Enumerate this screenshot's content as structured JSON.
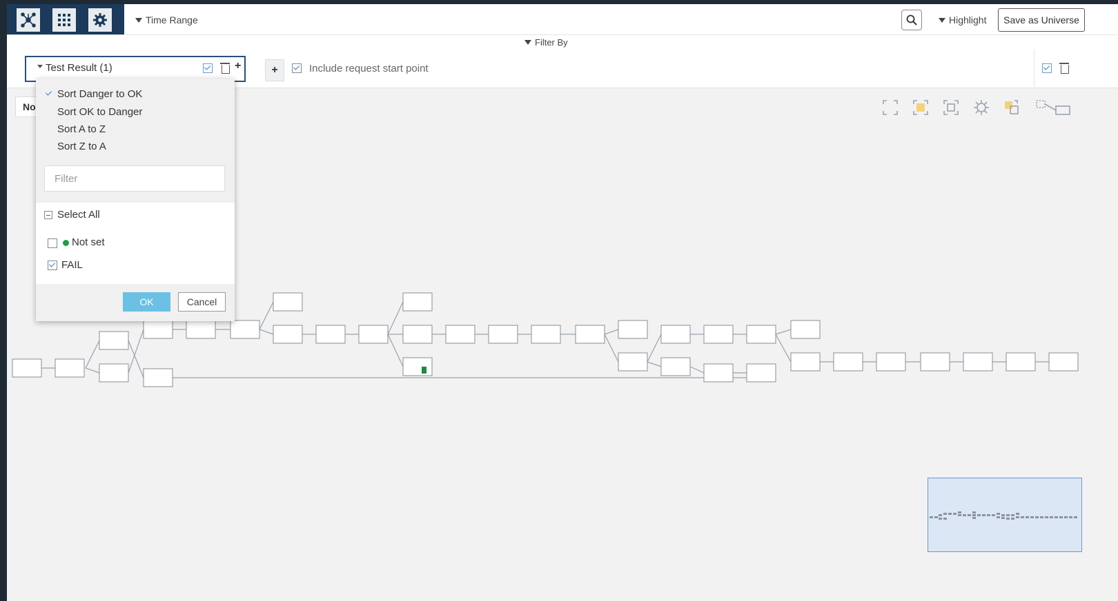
{
  "toolbar": {
    "time_range_label": "Time Range",
    "highlight_label": "Highlight",
    "save_label": "Save as Universe",
    "filter_by_label": "Filter By"
  },
  "filter": {
    "field_label": "Test Result (1)",
    "include_label": "Include request start point",
    "include_checked": true
  },
  "tab_label": "No",
  "dropdown": {
    "sort_options": [
      {
        "label": "Sort Danger to OK",
        "selected": true
      },
      {
        "label": "Sort OK to Danger",
        "selected": false
      },
      {
        "label": "Sort A to Z",
        "selected": false
      },
      {
        "label": "Sort Z to A",
        "selected": false
      }
    ],
    "filter_placeholder": "Filter",
    "select_all_label": "Select All",
    "values": [
      {
        "label": "Not set",
        "checked": false,
        "dot_color": "#1e9e4a"
      },
      {
        "label": "FAIL",
        "checked": true
      }
    ],
    "ok_label": "OK",
    "cancel_label": "Cancel"
  },
  "colors": {
    "nav_bg": "#1b3a5c",
    "accent": "#2a4f7a",
    "ok_button": "#6bc0e4",
    "minimap_bg": "#dbe7f5",
    "ok_status": "#1e9e4a"
  },
  "icons": {
    "nav": [
      "network-graph-icon",
      "grid-apps-icon",
      "settings-gear-icon"
    ],
    "graph_controls": [
      "expand-icon",
      "fit-selection-icon",
      "fit-view-icon",
      "layout-icon",
      "group-icon",
      "minimap-toggle-icon"
    ]
  }
}
